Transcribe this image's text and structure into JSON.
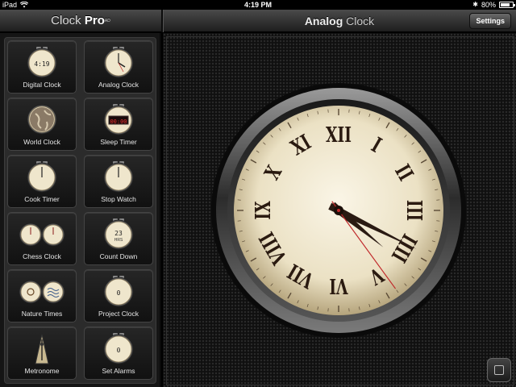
{
  "status_bar": {
    "device": "iPad",
    "time": "4:19 PM",
    "battery": "80%",
    "battery_level": 0.8
  },
  "app": {
    "title_light": "Clock ",
    "title_bold": "Pro",
    "title_mark": "AD"
  },
  "main_header": {
    "title_bold": "Analog",
    "title_light": " Clock",
    "settings_label": "Settings"
  },
  "sidebar": {
    "tiles": [
      {
        "label": "Digital Clock",
        "icon": "digital-clock-icon",
        "icon_text": "4:19"
      },
      {
        "label": "Analog Clock",
        "icon": "analog-clock-icon"
      },
      {
        "label": "World Clock",
        "icon": "globe-icon"
      },
      {
        "label": "Sleep Timer",
        "icon": "sleep-timer-icon",
        "icon_text": "00:00"
      },
      {
        "label": "Cook Timer",
        "icon": "cook-timer-icon"
      },
      {
        "label": "Stop Watch",
        "icon": "stopwatch-icon"
      },
      {
        "label": "Chess Clock",
        "icon": "chess-clock-icon"
      },
      {
        "label": "Count Down",
        "icon": "countdown-icon",
        "icon_text": "23",
        "icon_subtext": "HRS"
      },
      {
        "label": "Nature Times",
        "icon": "nature-times-icon"
      },
      {
        "label": "Project Clock",
        "icon": "project-clock-icon",
        "icon_text": "0"
      },
      {
        "label": "Metronome",
        "icon": "metronome-icon"
      },
      {
        "label": "Set Alarms",
        "icon": "alarm-icon",
        "icon_text": "0"
      }
    ]
  },
  "clock": {
    "numerals": [
      "XII",
      "I",
      "II",
      "III",
      "IIII",
      "V",
      "VI",
      "VII",
      "VIII",
      "IX",
      "X",
      "XI"
    ],
    "time": {
      "hour": 4,
      "minute": 19,
      "second": 24
    },
    "colors": {
      "face": "#efe6cc",
      "numeral": "#2a1a10",
      "hand": "#2a1a12",
      "second_hand": "#c0282a"
    }
  }
}
